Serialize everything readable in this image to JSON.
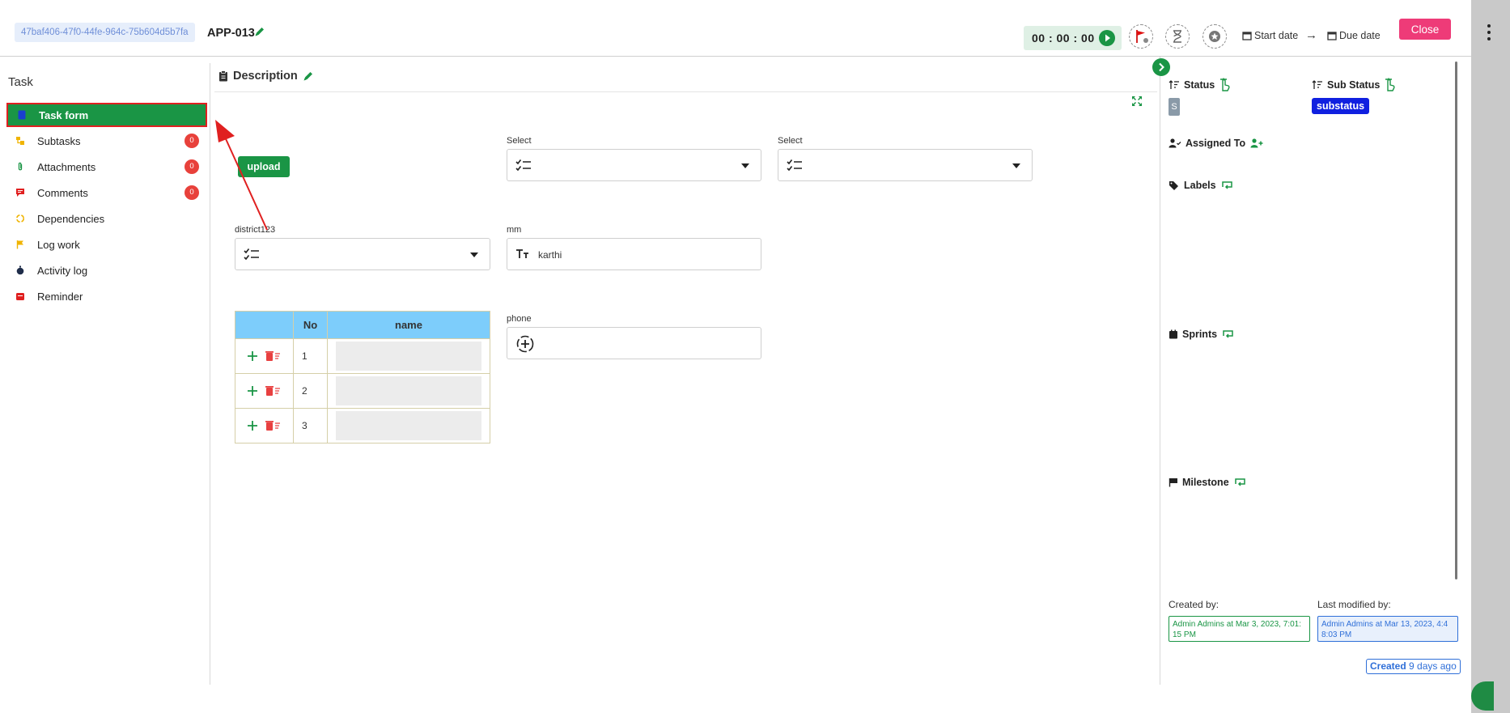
{
  "header": {
    "uuid": "47baf406-47f0-44fe-964c-75b604d5b7fa",
    "app_id": "APP-013",
    "timer": "00 : 00 : 00",
    "start_date_label": "Start date",
    "arrow": "→",
    "due_date_label": "Due date",
    "close_label": "Close"
  },
  "sidebar": {
    "title": "Task",
    "items": [
      {
        "label": "Task form",
        "icon": "form-icon",
        "active": true
      },
      {
        "label": "Subtasks",
        "icon": "subtasks-icon",
        "badge": "0"
      },
      {
        "label": "Attachments",
        "icon": "paperclip-icon",
        "badge": "0"
      },
      {
        "label": "Comments",
        "icon": "comment-icon",
        "badge": "0"
      },
      {
        "label": "Dependencies",
        "icon": "dependencies-icon"
      },
      {
        "label": "Log work",
        "icon": "flag-icon"
      },
      {
        "label": "Activity log",
        "icon": "stopwatch-icon"
      },
      {
        "label": "Reminder",
        "icon": "calendar-icon"
      }
    ]
  },
  "main": {
    "title": "Description",
    "upload_label": "upload",
    "select1_label": "Select",
    "select2_label": "Select",
    "district_label": "district123",
    "mm_label": "mm",
    "mm_value": "karthi",
    "phone_label": "phone",
    "table": {
      "headers": [
        "",
        "No",
        "name"
      ],
      "rows": [
        {
          "no": "1"
        },
        {
          "no": "2"
        },
        {
          "no": "3"
        }
      ]
    }
  },
  "right_panel": {
    "status_label": "Status",
    "status_value": "S",
    "sub_status_label": "Sub Status",
    "sub_status_value": "substatus",
    "assigned_to_label": "Assigned To",
    "labels_label": "Labels",
    "sprints_label": "Sprints",
    "milestone_label": "Milestone",
    "created_by_label": "Created by:",
    "created_by_value": "Admin Admins at Mar 3, 2023, 7:01: 15 PM",
    "last_modified_label": "Last modified by:",
    "last_modified_value": "Admin Admins at Mar 13, 2023, 4:4 8:03 PM",
    "created_chip_strong": "Created",
    "created_chip_rest": "9 days ago"
  },
  "colors": {
    "accent_green": "#1a9545",
    "close_pink": "#ee3b78",
    "badge_red": "#e8413b",
    "table_header_blue": "#7dcdfb",
    "substatus_blue": "#1020e0",
    "annotation_red": "#e02020"
  }
}
